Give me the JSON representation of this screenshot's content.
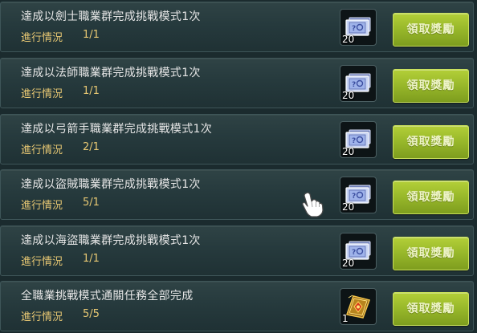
{
  "quests": [
    {
      "title": "達成以劍士職業群完成挑戰模式1次",
      "progress_label": "進行情況",
      "progress": "1/1",
      "reward_icon": "voucher-ticket-icon",
      "reward_count": "20",
      "button_label": "領取獎勵"
    },
    {
      "title": "達成以法師職業群完成挑戰模式1次",
      "progress_label": "進行情況",
      "progress": "1/1",
      "reward_icon": "voucher-ticket-icon",
      "reward_count": "20",
      "button_label": "領取獎勵"
    },
    {
      "title": "達成以弓箭手職業群完成挑戰模式1次",
      "progress_label": "進行情況",
      "progress": "2/1",
      "reward_icon": "voucher-ticket-icon",
      "reward_count": "20",
      "button_label": "領取獎勵"
    },
    {
      "title": "達成以盜賊職業群完成挑戰模式1次",
      "progress_label": "進行情況",
      "progress": "5/1",
      "reward_icon": "voucher-ticket-icon",
      "reward_count": "20",
      "button_label": "領取獎勵"
    },
    {
      "title": "達成以海盜職業群完成挑戰模式1次",
      "progress_label": "進行情況",
      "progress": "1/1",
      "reward_icon": "voucher-ticket-icon",
      "reward_count": "20",
      "button_label": "領取獎勵"
    },
    {
      "title": "全職業挑戰模式通關任務全部完成",
      "progress_label": "進行情況",
      "progress": "5/5",
      "reward_icon": "golden-spellbook-icon",
      "reward_count": "1",
      "button_label": "領取獎勵"
    }
  ],
  "colors": {
    "title_text": "#e6e6e6",
    "progress_text": "#e8c873",
    "button_green": "#97b72a",
    "row_background": "#263a3d"
  }
}
